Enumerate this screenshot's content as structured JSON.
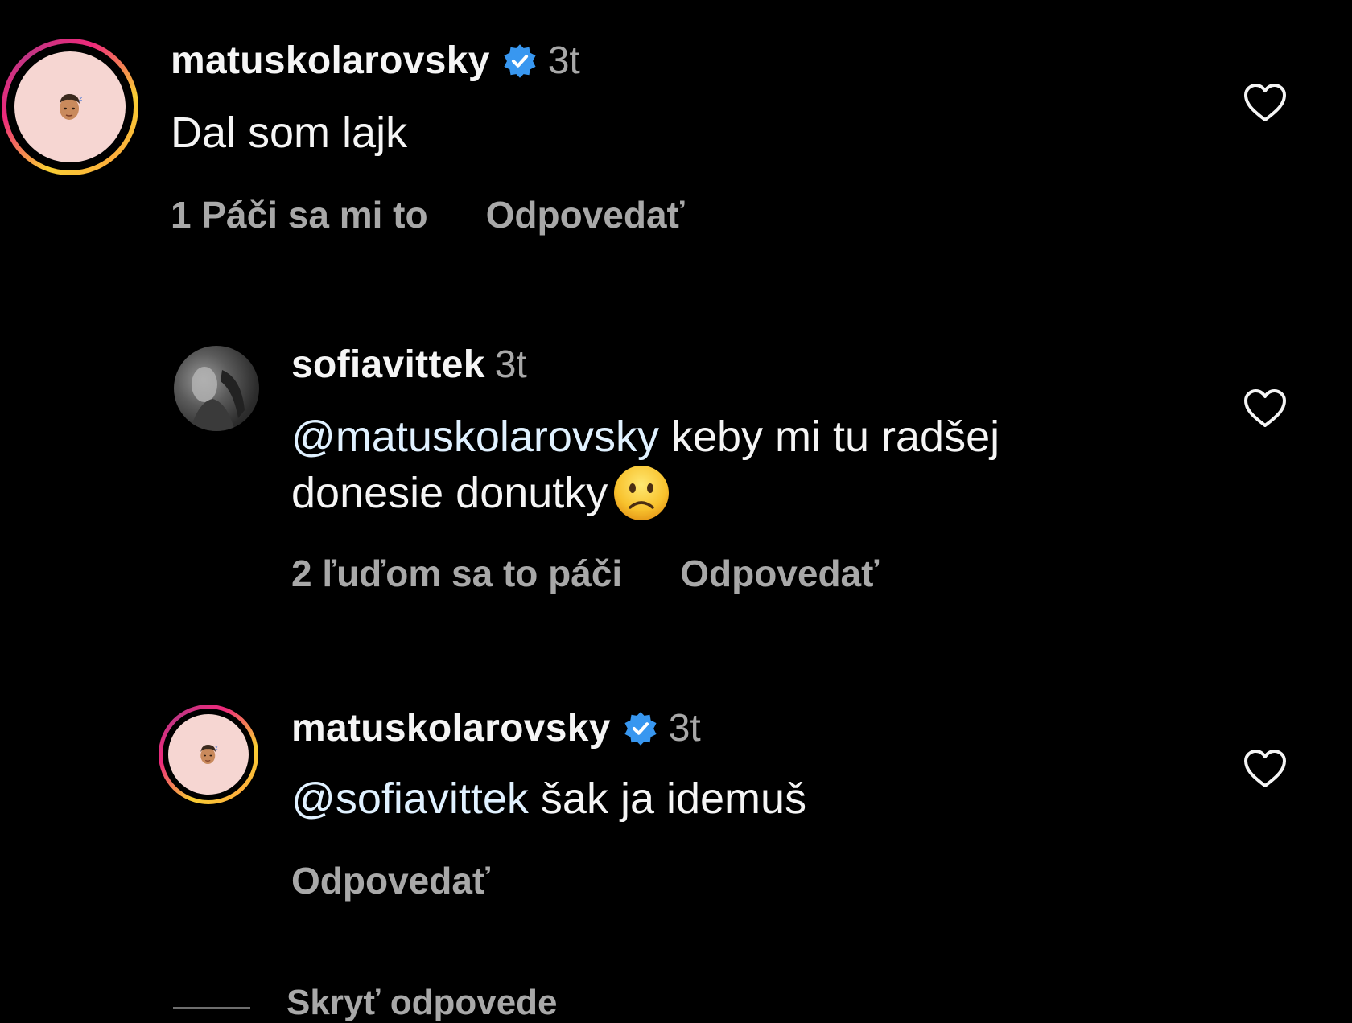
{
  "comments": [
    {
      "username": "matuskolarovsky",
      "verified": true,
      "time": "3t",
      "text": "Dal som lajk",
      "likes": "1 Páči sa mi to",
      "reply": "Odpovedať"
    },
    {
      "username": "sofiavittek",
      "verified": false,
      "time": "3t",
      "mention": "@matuskolarovsky",
      "text_line1": " keby mi tu radšej",
      "text_line2": "donesie donutky",
      "emoji": "confused-face",
      "likes": "2 ľuďom sa to páči",
      "reply": "Odpovedať"
    },
    {
      "username": "matuskolarovsky",
      "verified": true,
      "time": "3t",
      "mention": "@sofiavittek",
      "text": " šak ja idemuš",
      "reply": "Odpovedať"
    }
  ],
  "hide_replies": "Skryť odpovede",
  "colors": {
    "background": "#000000",
    "primary_text": "#f5f5f5",
    "secondary_text": "#a8a8a8",
    "verified_badge": "#3897f0",
    "story_ring": [
      "#f9ce34",
      "#ee2a7b",
      "#c13584"
    ]
  },
  "icons": {
    "verified": "verified-badge-icon",
    "like": "heart-outline-icon"
  }
}
